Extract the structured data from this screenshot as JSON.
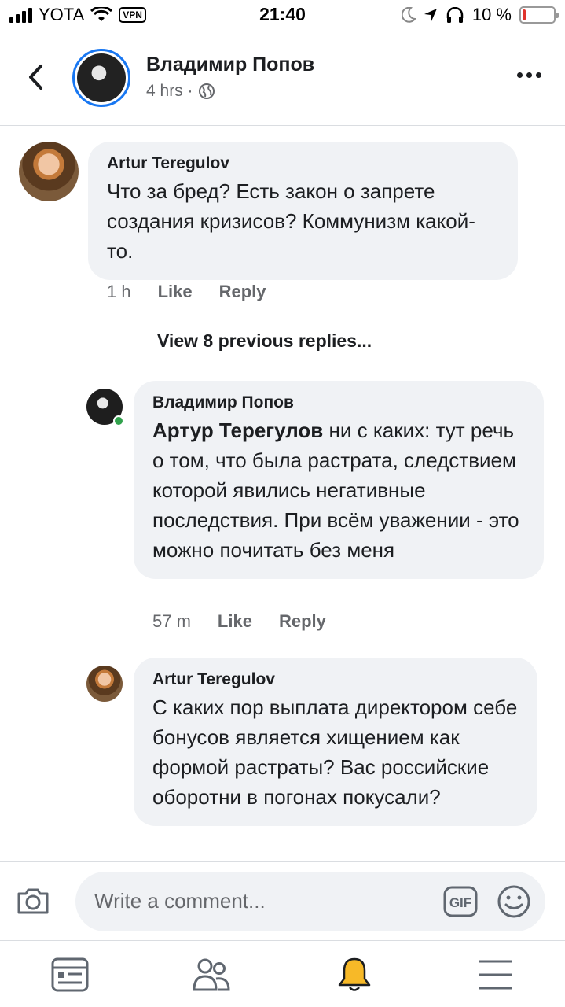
{
  "status_bar": {
    "carrier": "YOTA",
    "vpn": "VPN",
    "time": "21:40",
    "battery": "10 %",
    "battery_level": 0.1
  },
  "header": {
    "name": "Владимир Попов",
    "time": "4 hrs ·",
    "icons": [
      "back-chevron-icon",
      "globe-icon",
      "more-icon"
    ]
  },
  "comments": [
    {
      "author": "Artur Teregulov",
      "text": "Что за бред? Есть закон о запрете создания кризисов?  Коммунизм какой-то.",
      "time": "1 h",
      "like": "Like",
      "reply": "Reply"
    },
    {
      "author": "Владимир Попов",
      "mention": "Артур Терегулов",
      "text": " ни с каких: тут речь о том, что была растрата, следствием которой явились негативные последствия. При всём уважении - это можно почитать без меня",
      "time": "57 m",
      "like": "Like",
      "reply": "Reply"
    },
    {
      "author": "Artur Teregulov",
      "text": "С каких пор выплата директором себе бонусов является хищением как формой растраты? Вас российские оборотни в погонах покусали?"
    }
  ],
  "view_previous": "View 8 previous replies...",
  "composer": {
    "placeholder": "Write a comment...",
    "gif_label": "GIF",
    "icons": [
      "camera-icon",
      "gif-icon",
      "emoji-icon"
    ]
  },
  "tabs": [
    "news-feed-icon",
    "friends-icon",
    "notifications-bell-icon",
    "menu-icon"
  ],
  "colors": {
    "accent": "#1877f2",
    "bubble": "#f0f2f5",
    "online": "#31a24c",
    "bell": "#f7b928",
    "battery": "#e0342c"
  }
}
